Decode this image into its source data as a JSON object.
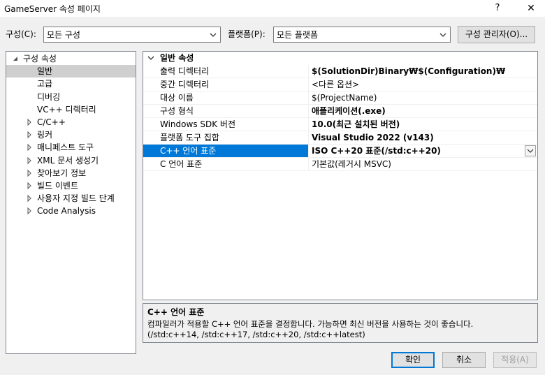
{
  "window": {
    "title": "GameServer 속성 페이지",
    "help_label": "?",
    "close_label": "✕"
  },
  "toolbar": {
    "config_label": "구성(C):",
    "config_value": "모든 구성",
    "platform_label": "플랫폼(P):",
    "platform_value": "모든 플랫폼",
    "config_manager_label": "구성 관리자(O)..."
  },
  "tree": {
    "items": [
      {
        "label": "구성 속성",
        "expander": "expanded"
      },
      {
        "label": "일반",
        "expander": "none",
        "selected": true
      },
      {
        "label": "고급",
        "expander": "none"
      },
      {
        "label": "디버깅",
        "expander": "none"
      },
      {
        "label": "VC++ 디렉터리",
        "expander": "none"
      },
      {
        "label": "C/C++",
        "expander": "collapsed"
      },
      {
        "label": "링커",
        "expander": "collapsed"
      },
      {
        "label": "매니페스트 도구",
        "expander": "collapsed"
      },
      {
        "label": "XML 문서 생성기",
        "expander": "collapsed"
      },
      {
        "label": "찾아보기 정보",
        "expander": "collapsed"
      },
      {
        "label": "빌드 이벤트",
        "expander": "collapsed"
      },
      {
        "label": "사용자 지정 빌드 단계",
        "expander": "collapsed"
      },
      {
        "label": "Code Analysis",
        "expander": "collapsed"
      }
    ]
  },
  "grid": {
    "section_label": "일반 속성",
    "rows": [
      {
        "name": "출력 디렉터리",
        "value": "$(SolutionDir)Binary₩$(Configuration)₩",
        "bold": true
      },
      {
        "name": "중간 디렉터리",
        "value": "<다른 옵션>",
        "bold": false
      },
      {
        "name": "대상 이름",
        "value": "$(ProjectName)",
        "bold": false
      },
      {
        "name": "구성 형식",
        "value": "애플리케이션(.exe)",
        "bold": true
      },
      {
        "name": "Windows SDK 버전",
        "value": "10.0(최근 설치된 버전)",
        "bold": true
      },
      {
        "name": "플랫폼 도구 집합",
        "value": "Visual Studio 2022 (v143)",
        "bold": true
      },
      {
        "name": "C++ 언어 표준",
        "value": "ISO C++20 표준(/std:c++20)",
        "bold": true,
        "selected": true
      },
      {
        "name": "C 언어 표준",
        "value": "기본값(레거시 MSVC)",
        "bold": false
      }
    ]
  },
  "description": {
    "title": "C++ 언어 표준",
    "line1": "컴파일러가 적용할 C++ 언어 표준을 결정합니다. 가능하면 최신 버전을 사용하는 것이 좋습니다.",
    "line2": "(/std:c++14, /std:c++17, /std:c++20, /std:c++latest)"
  },
  "footer": {
    "ok_label": "확인",
    "cancel_label": "취소",
    "apply_label": "적용(A)"
  },
  "colors": {
    "selection_blue": "#0078d7",
    "tree_selection": "#cfcfcf",
    "dialog_bg": "#f0f0f0"
  }
}
